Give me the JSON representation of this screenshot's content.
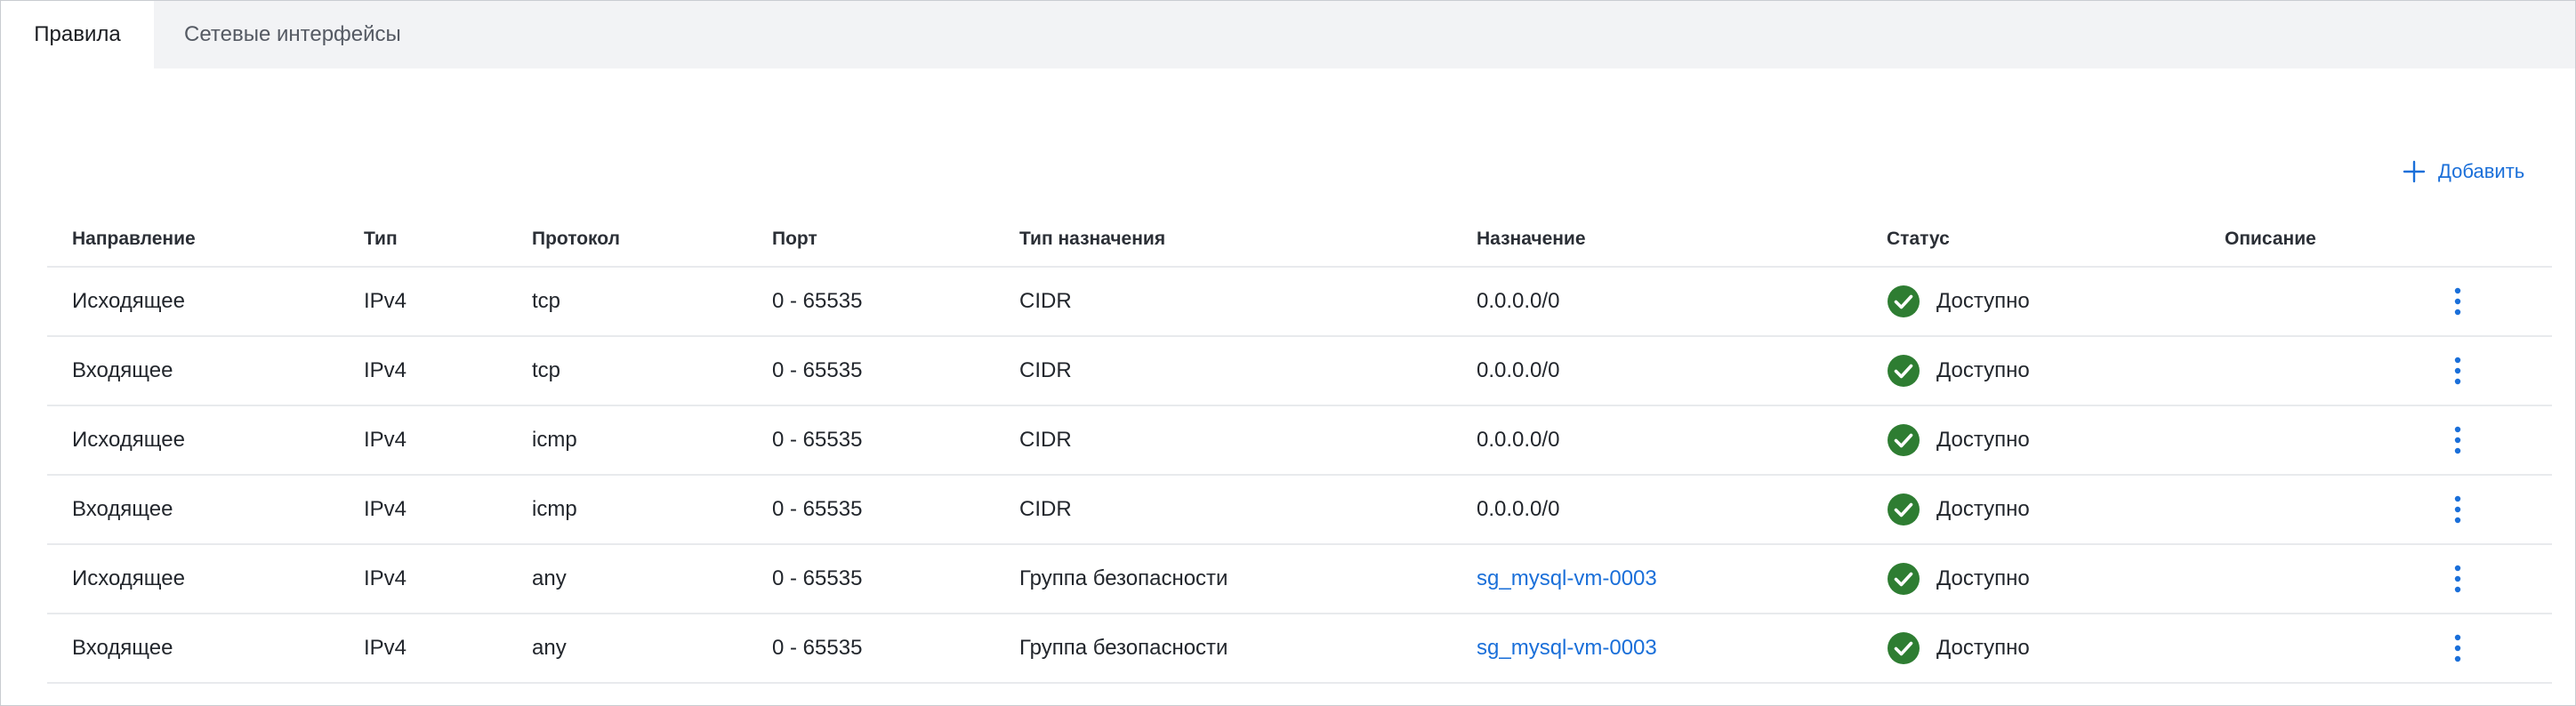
{
  "tabs": [
    {
      "label": "Правила",
      "active": true
    },
    {
      "label": "Сетевые интерфейсы",
      "active": false
    }
  ],
  "toolbar": {
    "add_label": "Добавить"
  },
  "table": {
    "columns": [
      "Направление",
      "Тип",
      "Протокол",
      "Порт",
      "Тип назначения",
      "Назначение",
      "Статус",
      "Описание"
    ],
    "rows": [
      {
        "direction": "Исходящее",
        "type": "IPv4",
        "protocol": "tcp",
        "port": "0 - 65535",
        "dest_type": "CIDR",
        "destination": "0.0.0.0/0",
        "destination_is_link": false,
        "status": "Доступно",
        "description": ""
      },
      {
        "direction": "Входящее",
        "type": "IPv4",
        "protocol": "tcp",
        "port": "0 - 65535",
        "dest_type": "CIDR",
        "destination": "0.0.0.0/0",
        "destination_is_link": false,
        "status": "Доступно",
        "description": ""
      },
      {
        "direction": "Исходящее",
        "type": "IPv4",
        "protocol": "icmp",
        "port": "0 - 65535",
        "dest_type": "CIDR",
        "destination": "0.0.0.0/0",
        "destination_is_link": false,
        "status": "Доступно",
        "description": ""
      },
      {
        "direction": "Входящее",
        "type": "IPv4",
        "protocol": "icmp",
        "port": "0 - 65535",
        "dest_type": "CIDR",
        "destination": "0.0.0.0/0",
        "destination_is_link": false,
        "status": "Доступно",
        "description": ""
      },
      {
        "direction": "Исходящее",
        "type": "IPv4",
        "protocol": "any",
        "port": "0 - 65535",
        "dest_type": "Группа безопасности",
        "destination": "sg_mysql-vm-0003",
        "destination_is_link": true,
        "status": "Доступно",
        "description": ""
      },
      {
        "direction": "Входящее",
        "type": "IPv4",
        "protocol": "any",
        "port": "0 - 65535",
        "dest_type": "Группа безопасности",
        "destination": "sg_mysql-vm-0003",
        "destination_is_link": true,
        "status": "Доступно",
        "description": ""
      }
    ]
  },
  "icons": {
    "add": "plus-icon",
    "status_ok": "check-circle-icon",
    "row_menu": "kebab-menu-icon"
  },
  "colors": {
    "accent": "#1a6fd9",
    "status_ok": "#2e7d32",
    "tabbar_bg": "#f2f3f5"
  }
}
